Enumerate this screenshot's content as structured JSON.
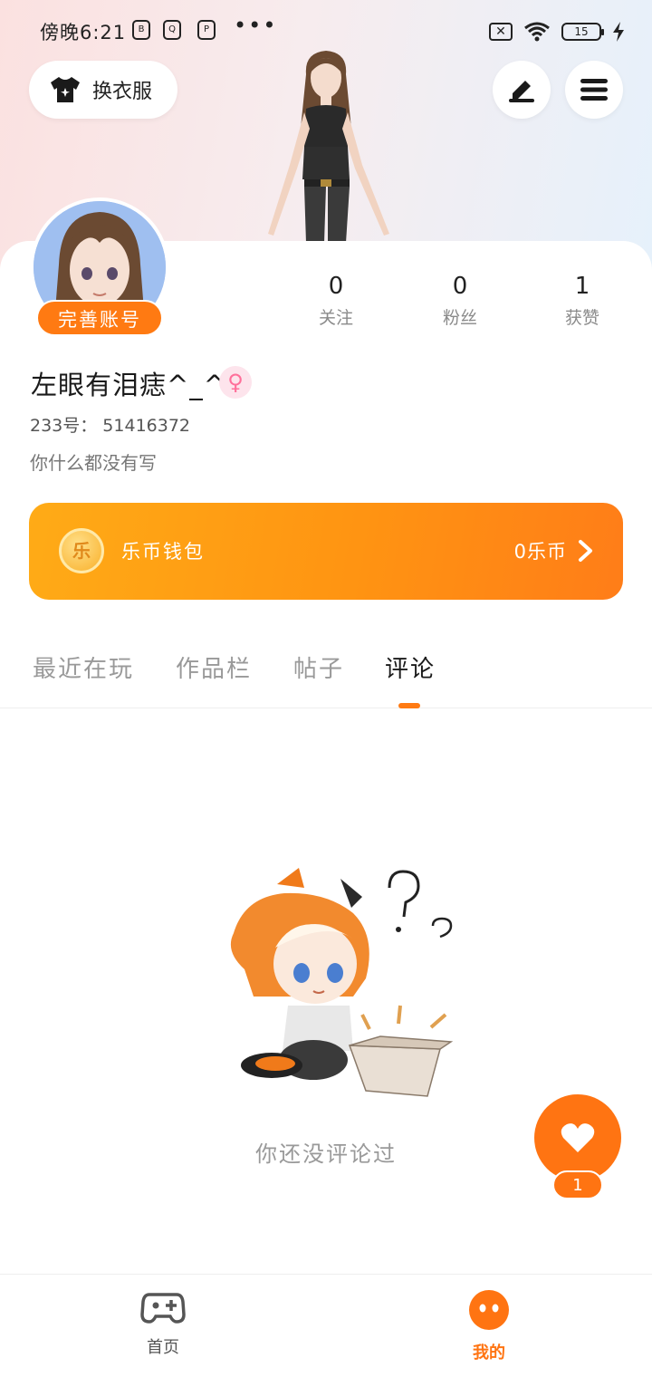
{
  "status_bar": {
    "time": "傍晚6:21",
    "apps": [
      "B",
      "Q",
      "P"
    ],
    "more": "•••",
    "sim": "✕",
    "battery": "15"
  },
  "header": {
    "outfit_label": "换衣服",
    "edit_icon": "pencil-icon",
    "menu_icon": "menu-icon"
  },
  "profile": {
    "complete_account_label": "完善账号",
    "stats": [
      {
        "value": "0",
        "label": "关注"
      },
      {
        "value": "0",
        "label": "粉丝"
      },
      {
        "value": "1",
        "label": "获赞"
      }
    ],
    "username": "左眼有泪痣^_^",
    "gender_symbol": "♀",
    "uid": "233号： 51416372",
    "bio": "你什么都没有写"
  },
  "wallet": {
    "coin_char": "乐",
    "title": "乐币钱包",
    "balance": "0乐币"
  },
  "tabs": [
    {
      "label": "最近在玩",
      "active": false
    },
    {
      "label": "作品栏",
      "active": false
    },
    {
      "label": "帖子",
      "active": false
    },
    {
      "label": "评论",
      "active": true
    }
  ],
  "empty_state": {
    "message": "你还没评论过"
  },
  "fab": {
    "icon": "heart-icon",
    "count": "1"
  },
  "bottom_nav": [
    {
      "label": "首页",
      "icon": "gamepad-icon",
      "active": false
    },
    {
      "label": "我的",
      "icon": "face-icon",
      "active": true
    }
  ],
  "colors": {
    "accent": "#ff7a12",
    "wallet_gradient_start": "#ffab16",
    "wallet_gradient_end": "#ff7d18",
    "inactive_text": "#999999"
  }
}
